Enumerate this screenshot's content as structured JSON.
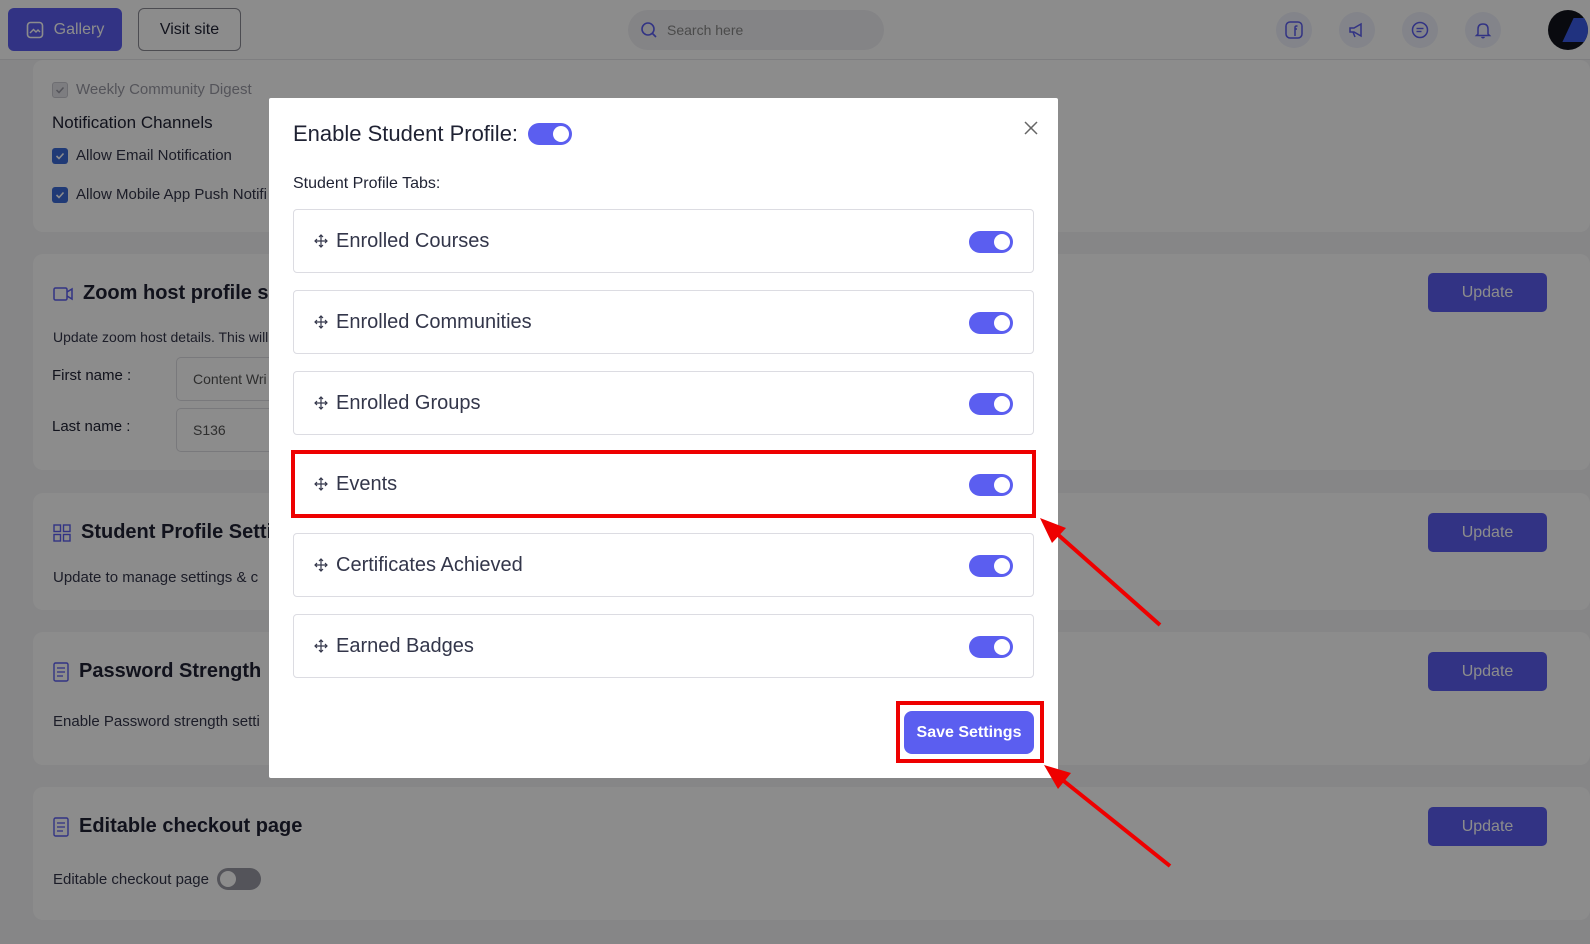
{
  "header": {
    "gallery_label": "Gallery",
    "visit_label": "Visit site",
    "search_placeholder": "Search here"
  },
  "notifications": {
    "digest_label": "Weekly Community Digest",
    "channels_title": "Notification Channels",
    "email_label": "Allow Email Notification",
    "push_label": "Allow Mobile App Push Notifi"
  },
  "zoom": {
    "title": "Zoom host profile se",
    "desc": "Update zoom host details. This will",
    "first_name_label": "First name",
    "first_name_value": "Content Wri",
    "last_name_label": "Last name",
    "last_name_value": "S136",
    "update_label": "Update"
  },
  "student_profile": {
    "title": "Student Profile Setti",
    "desc": "Update to manage settings & c",
    "update_label": "Update"
  },
  "password": {
    "title": "Password Strength",
    "desc": "Enable Password strength setti",
    "update_label": "Update"
  },
  "checkout": {
    "title": "Editable checkout page",
    "desc": "Editable checkout page",
    "update_label": "Update"
  },
  "modal": {
    "title": "Enable Student Profile:",
    "tabs_label": "Student Profile Tabs:",
    "tabs": [
      {
        "label": "Enrolled Courses",
        "enabled": true
      },
      {
        "label": "Enrolled Communities",
        "enabled": true
      },
      {
        "label": "Enrolled Groups",
        "enabled": true
      },
      {
        "label": "Events",
        "enabled": true
      },
      {
        "label": "Certificates Achieved",
        "enabled": true
      },
      {
        "label": "Earned Badges",
        "enabled": true
      }
    ],
    "save_label": "Save Settings"
  },
  "colors": {
    "accent": "#5b5ef0",
    "annotation": "#ee0000"
  }
}
